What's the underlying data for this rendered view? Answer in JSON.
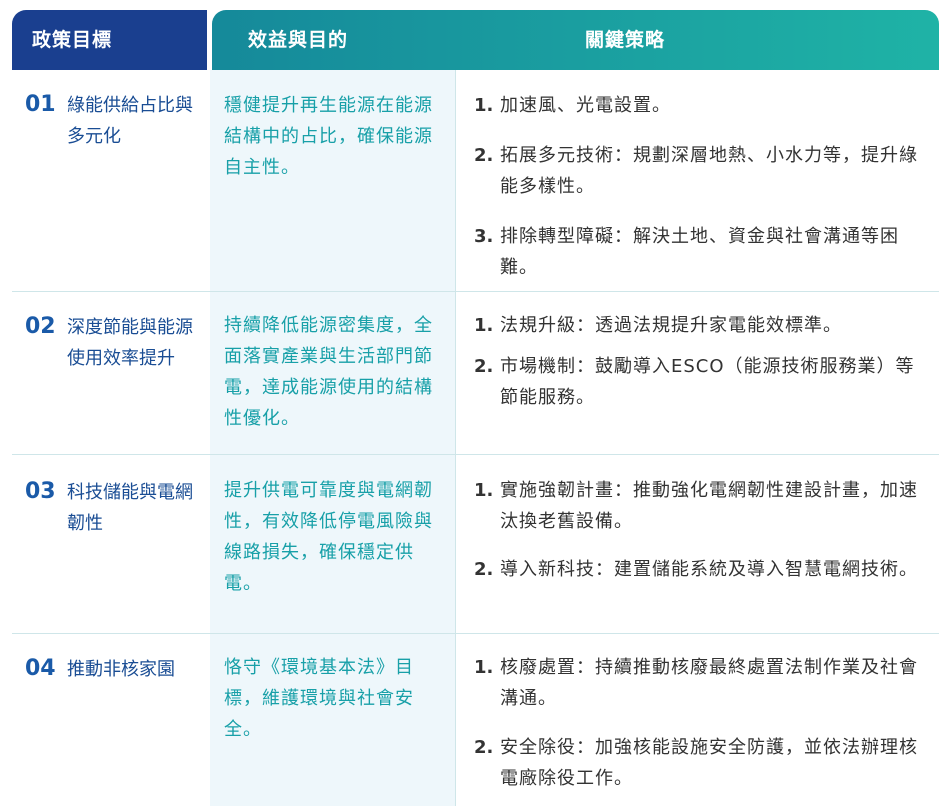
{
  "header": {
    "col1": "政策目標",
    "col2": "效益與目的",
    "col3": "關鍵策略"
  },
  "rows": [
    {
      "num": "01",
      "goal": "綠能供給占比與多元化",
      "benefit": "穩健提升再生能源在能源結構中的占比，確保能源自主性。",
      "strategies": [
        {
          "n": "1.",
          "text": "加速風、光電設置。"
        },
        {
          "n": "2.",
          "text": "拓展多元技術：規劃深層地熱、小水力等，提升綠能多樣性。"
        },
        {
          "n": "3.",
          "text": "排除轉型障礙：解決土地、資金與社會溝通等困難。"
        }
      ]
    },
    {
      "num": "02",
      "goal": "深度節能與能源使用效率提升",
      "benefit": "持續降低能源密集度，全面落實產業與生活部門節電，達成能源使用的結構性優化。",
      "strategies": [
        {
          "n": "1.",
          "text": "法規升級：透過法規提升家電能效標準。"
        },
        {
          "n": "2.",
          "text": "市場機制：鼓勵導入ESCO（能源技術服務業）等節能服務。"
        }
      ]
    },
    {
      "num": "03",
      "goal": "科技儲能與電網韌性",
      "benefit": "提升供電可靠度與電網韌性，有效降低停電風險與線路損失，確保穩定供電。",
      "strategies": [
        {
          "n": "1.",
          "text": "實施強韌計畫：推動強化電網韌性建設計畫，加速汰換老舊設備。"
        },
        {
          "n": "2.",
          "text": "導入新科技：建置儲能系統及導入智慧電網技術。"
        }
      ]
    },
    {
      "num": "04",
      "goal": "推動非核家園",
      "benefit": "恪守《環境基本法》目標，維護環境與社會安全。",
      "strategies": [
        {
          "n": "1.",
          "text": "核廢處置：持續推動核廢最終處置法制作業及社會溝通。"
        },
        {
          "n": "2.",
          "text": "安全除役：加強核能設施安全防護，並依法辦理核電廠除役工作。"
        }
      ]
    }
  ]
}
